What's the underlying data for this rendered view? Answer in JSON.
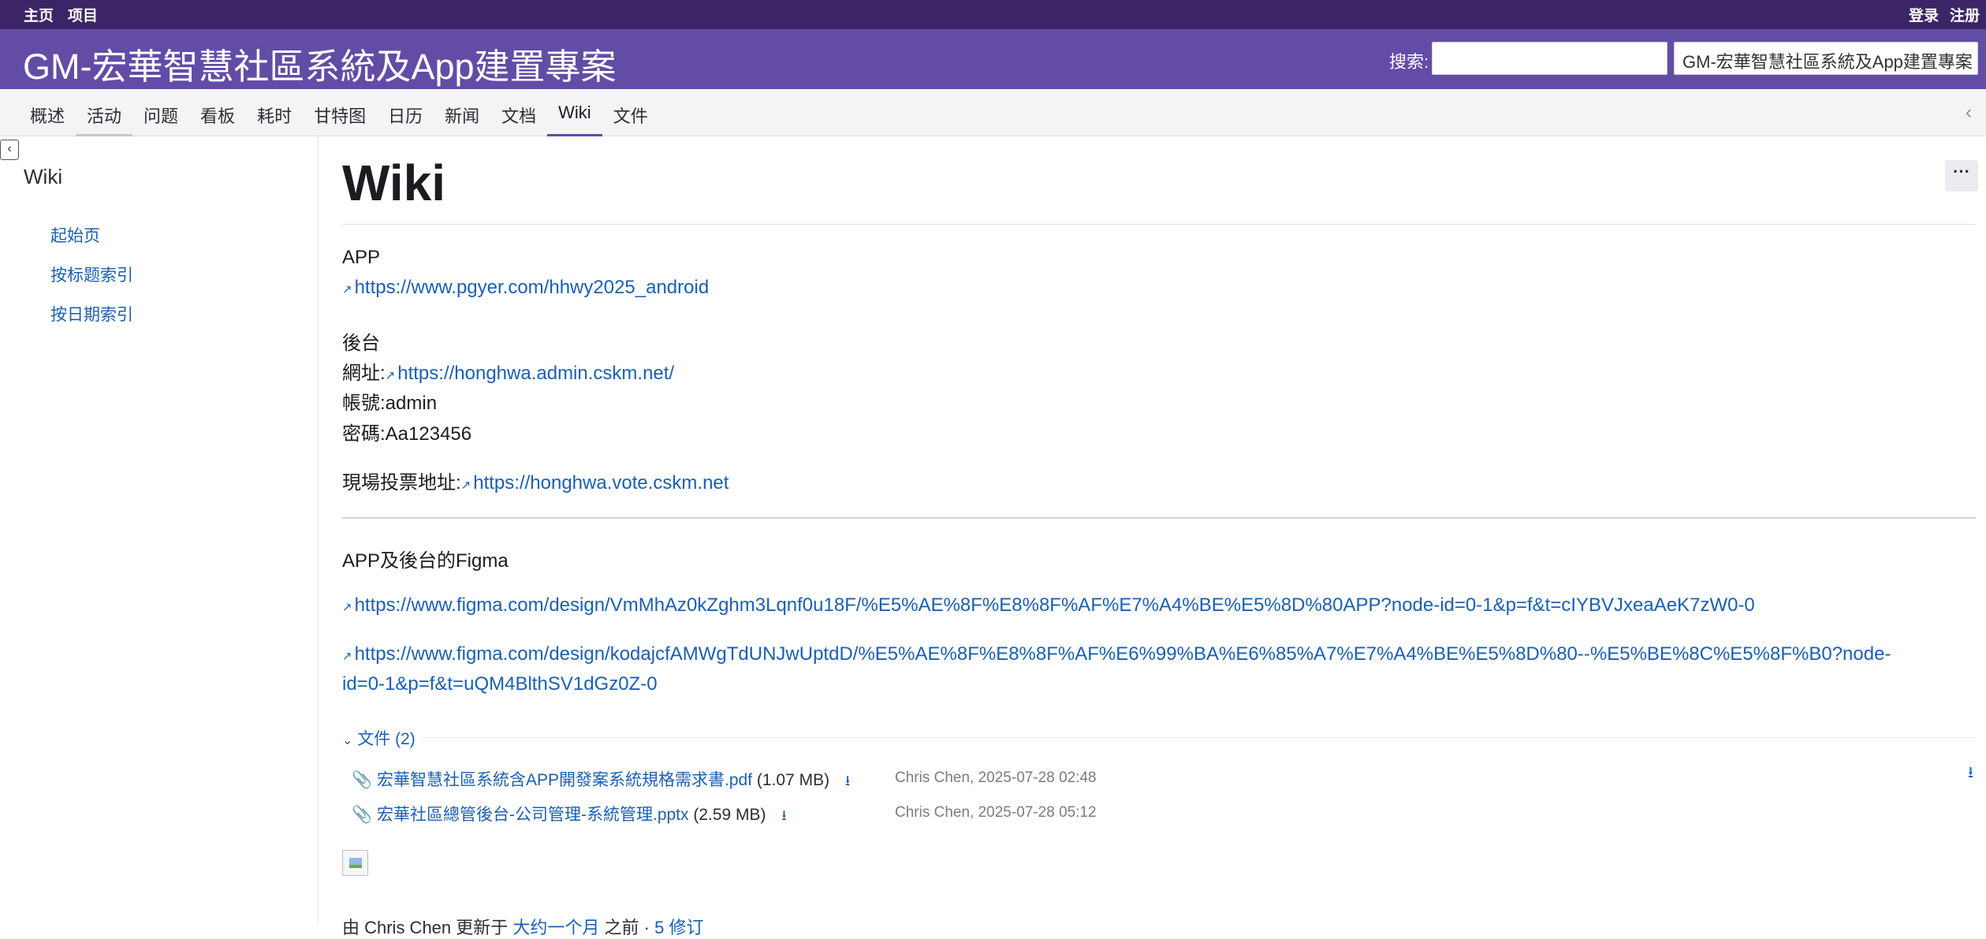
{
  "top_menu": {
    "home": "主页",
    "projects": "项目",
    "login": "登录",
    "register": "注册"
  },
  "header": {
    "title": "GM-宏華智慧社區系統及App建置專案",
    "search_label": "搜索:",
    "search_value": "",
    "project_select": "GM-宏華智慧社區系統及App建置專案"
  },
  "main_menu": {
    "tabs": [
      {
        "label": "概述"
      },
      {
        "label": "活动"
      },
      {
        "label": "问题"
      },
      {
        "label": "看板"
      },
      {
        "label": "耗时"
      },
      {
        "label": "甘特图"
      },
      {
        "label": "日历"
      },
      {
        "label": "新闻"
      },
      {
        "label": "文档"
      },
      {
        "label": "Wiki"
      },
      {
        "label": "文件"
      }
    ],
    "selected": "Wiki"
  },
  "sidebar": {
    "heading": "Wiki",
    "links": [
      "起始页",
      "按标题索引",
      "按日期索引"
    ]
  },
  "content": {
    "title": "Wiki",
    "actions_icon": "···",
    "app_label": "APP",
    "app_url": "https://www.pgyer.com/hhwy2025_android",
    "backend_label": "後台",
    "url_label": "網址:",
    "backend_url": "https://honghwa.admin.cskm.net/",
    "account_label": "帳號:",
    "account_value": "admin",
    "password_label": "密碼:",
    "password_value": "Aa123456",
    "vote_label": "現場投票地址:",
    "vote_url": "https://honghwa.vote.cskm.net",
    "figma_heading": "APP及後台的Figma",
    "figma_url_1": "https://www.figma.com/design/VmMhAz0kZghm3Lqnf0u18F/%E5%AE%8F%E8%8F%AF%E7%A4%BE%E5%8D%80APP?node-id=0-1&p=f&t=cIYBVJxeaAeK7zW0-0",
    "figma_url_2a": "https://www.figma.com/design/kodajcfAMWgTdUNJwUptdD/%E5%AE%8F%E8%8F%AF%E6%99%BA%E6%85%A7%E7%A4%BE%E5%8D%80--%E5%BE%8C%E5%8F%B0?node-",
    "figma_url_2b": "id=0-1&p=f&t=uQM4BlthSV1dGz0Z-0"
  },
  "files": {
    "heading": "文件 (2)",
    "items": [
      {
        "name": "宏華智慧社區系統含APP開發案系統規格需求書.pdf",
        "size": "(1.07 MB)",
        "meta": "Chris Chen, 2025-07-28 02:48"
      },
      {
        "name": "宏華社區總管後台-公司管理-系統管理.pptx",
        "size": "(2.59 MB)",
        "meta": "Chris Chen, 2025-07-28 05:12"
      }
    ]
  },
  "footer": {
    "updated_prefix": "由 Chris Chen 更新于",
    "updated_time": "大约一个月",
    "updated_suffix": "之前 ·",
    "revisions": "5 修订"
  },
  "colors": {
    "top_bar": "#3b2566",
    "header": "#634ca6",
    "link": "#1a5fb4"
  },
  "icons": [
    "external-link-icon",
    "chevron-down-icon",
    "paperclip-icon",
    "download-icon",
    "sidebar-collapse-icon",
    "chevron-left-icon",
    "more-actions-icon",
    "image-icon"
  ]
}
